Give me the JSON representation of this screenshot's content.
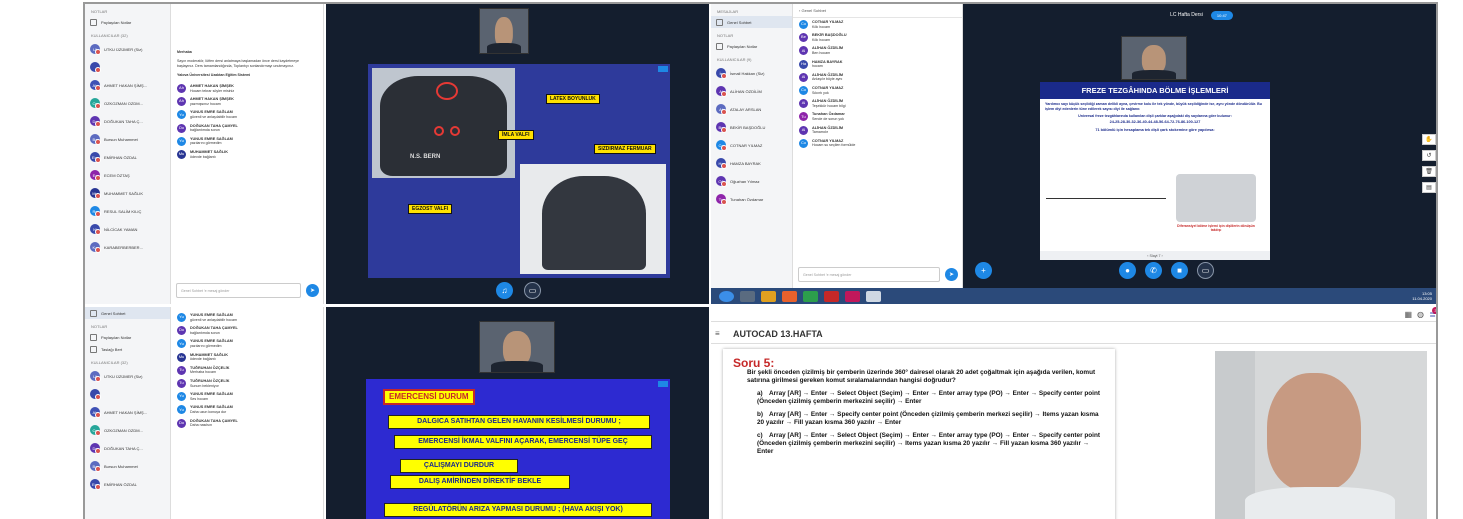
{
  "q1": {
    "sidebar": {
      "notes_section": "NOTLAR",
      "shared_notes": "Paylaşılan Notlar",
      "users_section": "KULLANICILAR (32)",
      "users": [
        {
          "initials": "Ut",
          "name": "UTKU ÜZÜMER (Siz)",
          "color": "#5c6bc0"
        },
        {
          "initials": "",
          "name": "",
          "color": "#3949ab"
        },
        {
          "initials": "Ah",
          "name": "AHMET HAKAN ŞİMŞ...",
          "color": "#3f51b5"
        },
        {
          "initials": "Oz",
          "name": "OZKOZMAN OZDM...",
          "color": "#26a69a"
        },
        {
          "initials": "Do",
          "name": "DOĞUKAN TAHA Ç...",
          "color": "#5e35b1"
        },
        {
          "initials": "Ba",
          "name": "Bursun Muhammet",
          "color": "#5c6bc0"
        },
        {
          "initials": "Em",
          "name": "EMİRHAN ÖZDAL",
          "color": "#3949ab"
        },
        {
          "initials": "Ec",
          "name": "ECEM ÖZTAŞ",
          "color": "#8e24aa"
        },
        {
          "initials": "Mu",
          "name": "MUHAMMET SAĞLIK",
          "color": "#283593"
        },
        {
          "initials": "Re",
          "name": "RESUL SALİM KILIÇ",
          "color": "#1e88e5"
        },
        {
          "initials": "Ni",
          "name": "NİLCİCAK YAMAN",
          "color": "#3949ab"
        },
        {
          "initials": "Ka",
          "name": "KARABERBERBER...",
          "color": "#5c6bc0"
        }
      ]
    },
    "chat": {
      "header": "Mesajlar",
      "welcome_title": "Merhaba",
      "welcome_body": "Sayın moderatör, lütfen dersi anlatmaya başlamadan önce dersi kaydetmeye başlayınız. Ders tamamlandığında, Toplantıyı sonlandırmayı unutmayınız.",
      "welcome_sign": "Yalova Üniversitesi Uzaktan Eğitim Sistemi",
      "messages": [
        {
          "initials": "Ah",
          "name": "AHMET HAKAN ŞİMŞEK",
          "text": "Hocam tekrar söyler misiniz",
          "color": "#5e35b1"
        },
        {
          "initials": "Ah",
          "name": "AHMET HAKAN ŞİMŞEK",
          "text": "yazmışsınız hocam",
          "color": "#5e35b1"
        },
        {
          "initials": "Yu",
          "name": "YUNUS EMRE SAĞLAM",
          "text": "güvenli ve anlaşılabilir hocam",
          "color": "#1e88e5"
        },
        {
          "initials": "Do",
          "name": "DOĞUKAN TAHA ÇAMYEL",
          "text": "bağlantımda sorun",
          "color": "#5e35b1"
        },
        {
          "initials": "Yu",
          "name": "YUNUS EMRE SAĞLAM",
          "text": "yazılarını görmedim",
          "color": "#1e88e5"
        },
        {
          "initials": "Mu",
          "name": "MUHAMMET SAĞLIK",
          "text": "ödevde bağlantı",
          "color": "#283593"
        }
      ],
      "input_placeholder": "Genel Sohbet 'e mesaj gönder"
    },
    "slide": {
      "labels": {
        "latex": "LATEX BOYUNLUK",
        "inflate": "İMLA VALFI",
        "zipper": "SIZDIRMAZ FERMUAR",
        "exhaust": "EGZOST VALFI"
      },
      "suit_text": "N.S. BERN"
    }
  },
  "q2": {
    "sidebar": {
      "messages_section": "MESAJLAR",
      "public_chat": "Genel Sohbet",
      "notes_section": "NOTLAR",
      "shared_notes": "Paylaşılan Notlar",
      "users_section": "KULLANICILAR (9)",
      "users": [
        {
          "initials": "İs",
          "name": "İsmail Hakkan (Siz)",
          "color": "#3949ab"
        },
        {
          "initials": "Al",
          "name": "ALİHAN ÖZDİLİM",
          "color": "#5e35b1"
        },
        {
          "initials": "At",
          "name": "ATALAY ARSLAN",
          "color": "#5c6bc0"
        },
        {
          "initials": "Be",
          "name": "BEKİR BAŞDOĞLU",
          "color": "#5e35b1"
        },
        {
          "initials": "Co",
          "name": "COTNAR YILMAZ",
          "color": "#1e88e5"
        },
        {
          "initials": "Ha",
          "name": "HAMZA BAYRAK",
          "color": "#3949ab"
        },
        {
          "initials": "Oğ",
          "name": "Oğuzhan Yılmaz",
          "color": "#5e35b1"
        },
        {
          "initials": "Tu",
          "name": "Tunahan Özdamar",
          "color": "#8e24aa"
        }
      ]
    },
    "chat": {
      "header": "Genel Sohbet",
      "messages": [
        {
          "initials": "Co",
          "name": "COTNAR YILMAZ",
          "text": "Kök hocam",
          "color": "#1e88e5"
        },
        {
          "initials": "Be",
          "name": "BEKİR BAŞDOĞLU",
          "text": "Kök hocam",
          "color": "#5e35b1"
        },
        {
          "initials": "Al",
          "name": "ALİHAN ÖZDİLİM",
          "text": "Ben hocam",
          "color": "#5e35b1"
        },
        {
          "initials": "Ha",
          "name": "HAMZA BAYRAK",
          "text": "hocam",
          "color": "#3949ab"
        },
        {
          "initials": "Al",
          "name": "ALİHAN ÖZDİLİM",
          "text": "Anlaşılır böyle aynı",
          "color": "#5e35b1"
        },
        {
          "initials": "Co",
          "name": "COTNAR YILMAZ",
          "text": "Sıkıntı yok",
          "color": "#1e88e5"
        },
        {
          "initials": "Al",
          "name": "ALİHAN ÖZDİLİM",
          "text": "Teşekkür hocam bilgi",
          "color": "#5e35b1"
        },
        {
          "initials": "Tu",
          "name": "Tunahan Özdamar",
          "text": "Sende de sorun yok",
          "color": "#8e24aa"
        },
        {
          "initials": "Al",
          "name": "ALİHAN ÖZDİLİM",
          "text": "Tamamdır",
          "color": "#5e35b1"
        },
        {
          "initials": "Co",
          "name": "COTNAR YILMAZ",
          "text": "Hocam su seçilen formülde",
          "color": "#1e88e5"
        }
      ],
      "input_placeholder": "Genel Sohbet 'e mesaj gönder"
    },
    "topbar": {
      "title": "LC Hafta Dersi",
      "rec": "10:47"
    },
    "slide": {
      "title": "FREZE TEZGÂHINDA BÖLME İŞLEMLERİ",
      "line1": "Yardımcı sayı küçük seçildiği zaman delikli ayna, çevirme kolu ile tek yönde, büyük seçildiğinde ise, aynı yönde döndürülür. Bu işlem diyi edenlerin tüne edilerek sayısı diyi ile sağlanır.",
      "line2": "Universal freze tezgâhlarında kullanılan dişli çarklar aşağıdaki diş sayılarına göre bulunur:",
      "numbers": "24-25-28-30-32-36-40-44-48-56-64-72-76-86-100-127",
      "line3": "71 bölümlü için hesaplama tek dişli çark stokemine göre yapılırsa:",
      "caption": "Diferansiyel bölme işlemi için dişlilerin dönüşün takılışı",
      "pager": "Slayt 7"
    },
    "taskbar": {
      "time": "13:05",
      "date": "11.04.2020"
    }
  },
  "q3": {
    "sidebar": {
      "public_chat": "Genel Sohbet",
      "notes_section": "NOTLAR",
      "shared_notes": "Paylaşılan Notlar",
      "notes2": "Taslağı Bert",
      "users_section": "KULLANICILAR (32)",
      "users": [
        {
          "initials": "Ut",
          "name": "UTKU ÜZÜMER (Siz)",
          "color": "#5c6bc0"
        },
        {
          "initials": "",
          "name": "",
          "color": "#3949ab"
        },
        {
          "initials": "Ah",
          "name": "AHMET HAKAN ŞİMŞ...",
          "color": "#3f51b5"
        },
        {
          "initials": "Oz",
          "name": "OZKOZMAN OZDM...",
          "color": "#26a69a"
        },
        {
          "initials": "Do",
          "name": "DOĞUKAN TAHA Ç...",
          "color": "#5e35b1"
        },
        {
          "initials": "Ba",
          "name": "Bursun Muhammet",
          "color": "#5c6bc0"
        },
        {
          "initials": "Em",
          "name": "EMİRHAN ÖZDAL",
          "color": "#3949ab"
        }
      ]
    },
    "chat": {
      "messages": [
        {
          "initials": "Yu",
          "name": "YUNUS EMRE SAĞLAM",
          "text": "güvenli ve anlaşılabilir hocam",
          "color": "#1e88e5"
        },
        {
          "initials": "Do",
          "name": "DOĞUKAN TAHA ÇAMYEL",
          "text": "bağlantımda sorun",
          "color": "#5e35b1"
        },
        {
          "initials": "Yu",
          "name": "YUNUS EMRE SAĞLAM",
          "text": "yazılarını görmedim",
          "color": "#1e88e5"
        },
        {
          "initials": "Mu",
          "name": "MUHAMMET SAĞLIK",
          "text": "ödevde bağlantı",
          "color": "#283593"
        },
        {
          "initials": "Tu",
          "name": "TUĞRUHAN ÖZÇELİK",
          "text": "Merhaba hocam",
          "color": "#5e35b1"
        },
        {
          "initials": "Tu",
          "name": "TUĞRUHAN ÖZÇELİK",
          "text": "Sunum bekleniyor",
          "color": "#5e35b1"
        },
        {
          "initials": "Yu",
          "name": "YUNUS EMRE SAĞLAM",
          "text": "Ses hocam",
          "color": "#1e88e5"
        },
        {
          "initials": "Yu",
          "name": "YUNUS EMRE SAĞLAM",
          "text": "Daha uzun konuşa dur",
          "color": "#1e88e5"
        },
        {
          "initials": "Do",
          "name": "DOĞUKAN TAHA ÇAMYEL",
          "text": "Daha nasılsın",
          "color": "#5e35b1"
        }
      ]
    },
    "slide": {
      "title": "EMERCENSİ DURUM",
      "items": [
        "DALGICA SATIHTAN GELEN HAVANIN KESİLMESİ DURUMU ;",
        "EMERCENSİ İKMAL VALFINI AÇARAK, EMERCENSİ TÜPE GEÇ",
        "ÇALIŞMAYI DURDUR",
        "DALIŞ AMİRİNDEN DİREKTİF BEKLE",
        "REGÜLATÖRÜN ARIZA YAPMASI DURUMU ; (HAVA AKIŞI YOK)"
      ]
    }
  },
  "q4": {
    "title": "AUTOCAD 13.HAFTA",
    "question_title": "Soru 5:",
    "question": "Bir şekli önceden çizilmiş bir çemberin üzerinde 360° dairesel olarak 20 adet çoğaltmak için aşağıda verilen, komut satırına girilmesi gereken komut sıralamalarından hangisi doğrudur?",
    "options": [
      {
        "letter": "a)",
        "text": "Array [AR] → Enter → Select Object (Seçim) → Enter → Enter array type (PO) → Enter → Specify center point (Önceden çizilmiş çemberin merkezini seçilir) → Enter"
      },
      {
        "letter": "b)",
        "text": "Array [AR] → Enter → Specify center point (Önceden çizilmiş çemberin merkezi seçilir) → Items yazan kısma 20 yazılır → Fill yazan kısma 360 yazılır → Enter"
      },
      {
        "letter": "c)",
        "text": "Array [AR] → Enter → Select Object (Seçim) → Enter → Enter array type (PO) → Enter → Specify center point (Önceden çizilmiş çemberin merkezini seçilir) → Items yazan kısma 20 yazılır → Fill yazan kısma 360 yazılır → Enter"
      }
    ],
    "notification_count": "3"
  }
}
